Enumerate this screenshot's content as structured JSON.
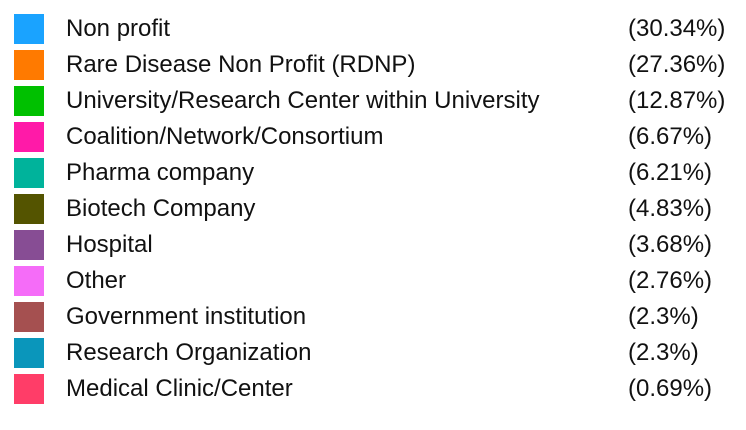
{
  "chart_data": {
    "type": "pie",
    "title": "",
    "legend_position": "list",
    "slices": [
      {
        "label": "Non profit",
        "value": 30.34,
        "value_label": "(30.34%)",
        "color": "#1aa3ff"
      },
      {
        "label": "Rare Disease Non Profit (RDNP)",
        "value": 27.36,
        "value_label": "(27.36%)",
        "color": "#ff7a00"
      },
      {
        "label": "University/Research Center within University",
        "value": 12.87,
        "value_label": "(12.87%)",
        "color": "#00c000"
      },
      {
        "label": "Coalition/Network/Consortium",
        "value": 6.67,
        "value_label": "(6.67%)",
        "color": "#ff1aa8"
      },
      {
        "label": "Pharma company",
        "value": 6.21,
        "value_label": "(6.21%)",
        "color": "#00b39b"
      },
      {
        "label": "Biotech Company",
        "value": 4.83,
        "value_label": "(4.83%)",
        "color": "#545400"
      },
      {
        "label": "Hospital",
        "value": 3.68,
        "value_label": "(3.68%)",
        "color": "#874d94"
      },
      {
        "label": "Other",
        "value": 2.76,
        "value_label": "(2.76%)",
        "color": "#f56cf8"
      },
      {
        "label": "Government institution",
        "value": 2.3,
        "value_label": "(2.3%)",
        "color": "#a55050"
      },
      {
        "label": "Research Organization",
        "value": 2.3,
        "value_label": "(2.3%)",
        "color": "#0a96bb"
      },
      {
        "label": "Medical Clinic/Center",
        "value": 0.69,
        "value_label": "(0.69%)",
        "color": "#ff3d68"
      }
    ]
  }
}
